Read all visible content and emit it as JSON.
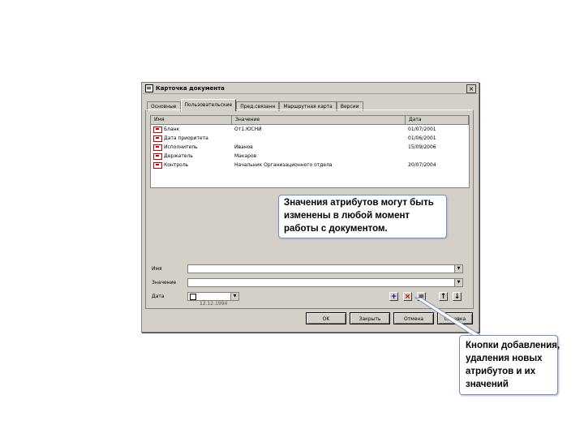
{
  "window": {
    "title": "Карточка документа",
    "close_label": "×"
  },
  "tabs": [
    "Основные",
    "Пользовательские",
    "Пред.связанн",
    "Маршрутная карта",
    "Версии"
  ],
  "active_tab": 1,
  "attributes_table": {
    "columns": [
      "Имя",
      "Значение",
      "Дата"
    ],
    "rows": [
      {
        "name": "Бланк",
        "value": "От1.ЮСНИ",
        "date": "01/07/2001"
      },
      {
        "name": "Дата приоритета",
        "value": "",
        "date": "01/06/2001"
      },
      {
        "name": "Исполнитель",
        "value": "Иванов",
        "date": "15/09/2006"
      },
      {
        "name": "Держатель",
        "value": "Макаров",
        "date": ""
      },
      {
        "name": "Контроль",
        "value": "Начальник Организационного отдела",
        "date": "20/07/2004"
      }
    ]
  },
  "form": {
    "name_label": "Имя",
    "value_label": "Значение",
    "date_label": "Дата",
    "date_value": "12.12.1994"
  },
  "editor_buttons": {
    "add": "+",
    "delete": "×",
    "equals": "=",
    "up": "↑",
    "down": "↓"
  },
  "dialog_buttons": [
    "OK",
    "Закрыть",
    "Отмена",
    "Справка"
  ],
  "callouts": {
    "values": [
      "Значения атрибутов могут быть",
      "изменены в любой момент",
      "работы с документом."
    ],
    "buttons": [
      "Кнопки добавления,",
      "удаления новых",
      "атрибутов и их",
      "значений"
    ]
  },
  "colors": {
    "dialog_bg": "#d4d0c8",
    "callout_border": "#7a8fb8",
    "add_icon": "#0000a0",
    "delete_icon": "#c00000"
  }
}
